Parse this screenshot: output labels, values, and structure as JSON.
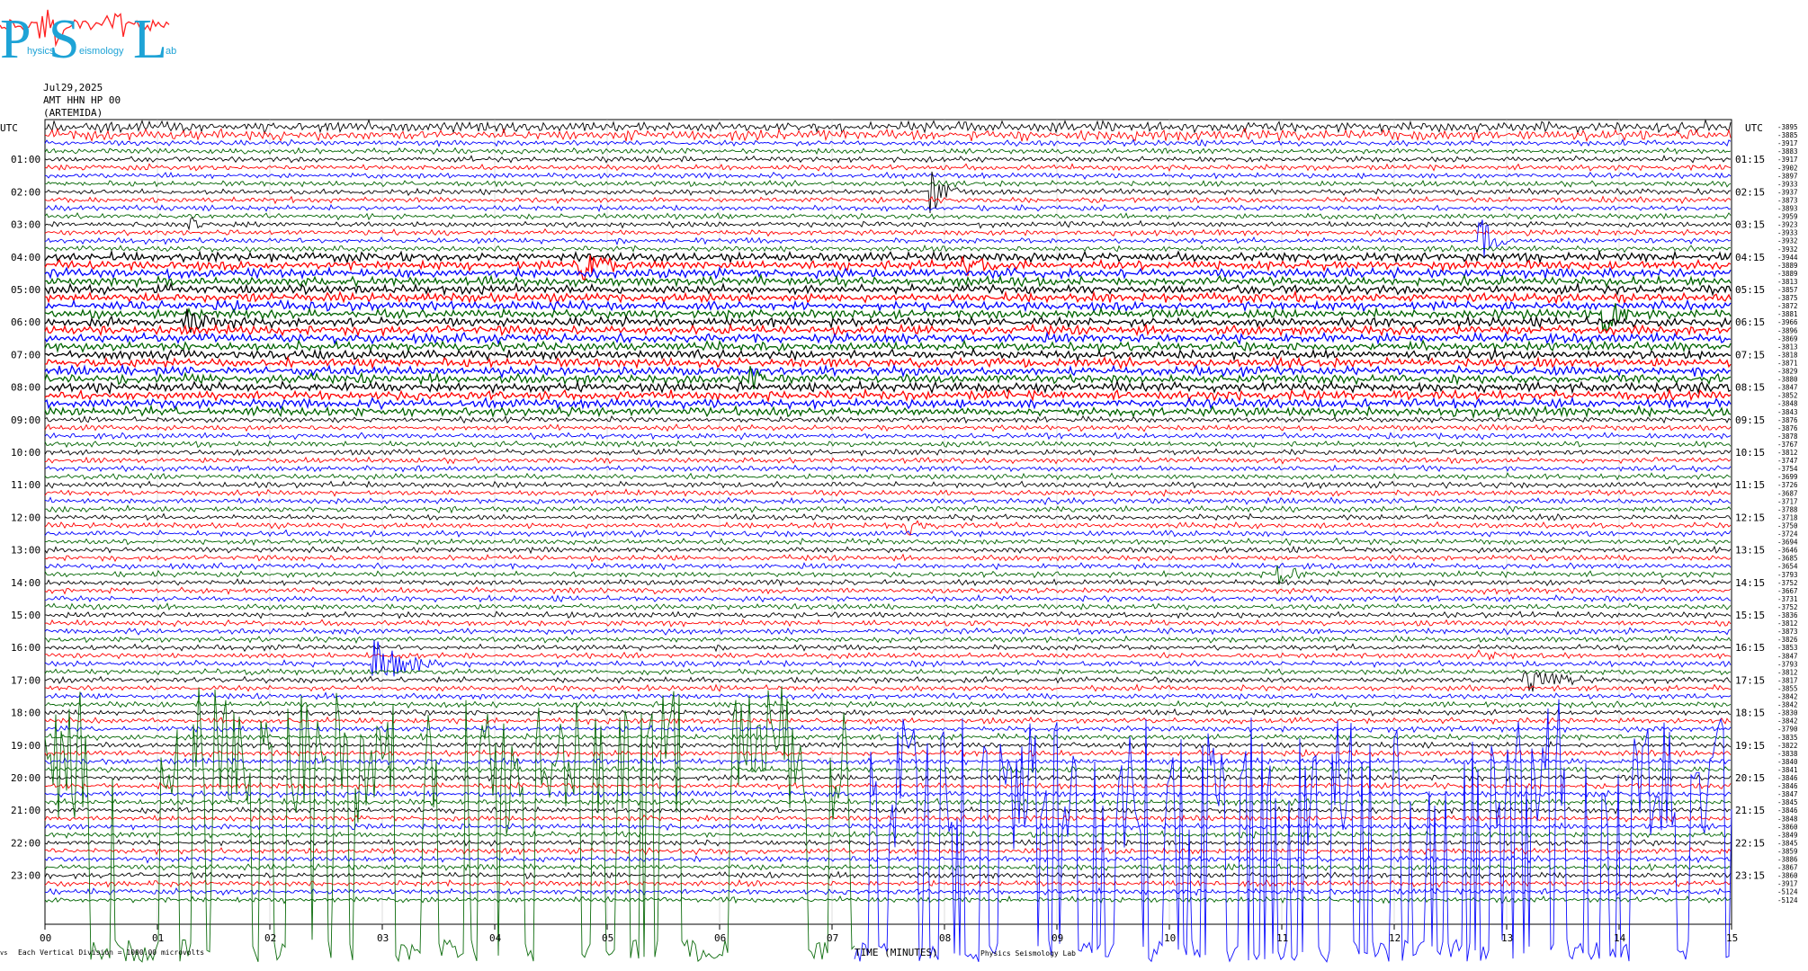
{
  "logo": {
    "letters": [
      "P",
      "S",
      "L"
    ],
    "words": [
      "hysics",
      "eismology",
      "ab"
    ],
    "color": "#1ea3d6",
    "trace_color": "#ff2020"
  },
  "header": {
    "date": "Jul29,2025",
    "channel": "AMT HHN HP 00",
    "station": "(ARTEMIDA)"
  },
  "axis": {
    "left_unit": "UTC",
    "right_unit": "UTC",
    "minute_ticks": [
      "00",
      "01",
      "02",
      "03",
      "04",
      "05",
      "06",
      "07",
      "08",
      "09",
      "10",
      "11",
      "12",
      "13",
      "14",
      "15"
    ],
    "left_hours": [
      "01:00",
      "02:00",
      "03:00",
      "04:00",
      "05:00",
      "06:00",
      "07:00",
      "08:00",
      "09:00",
      "10:00",
      "11:00",
      "12:00",
      "13:00",
      "14:00",
      "15:00",
      "16:00",
      "17:00",
      "18:00",
      "19:00",
      "20:00",
      "21:00",
      "22:00",
      "23:00"
    ],
    "right_hours": [
      "01:15",
      "02:15",
      "03:15",
      "04:15",
      "05:15",
      "06:15",
      "07:15",
      "08:15",
      "09:15",
      "10:15",
      "11:15",
      "12:15",
      "13:15",
      "14:15",
      "15:15",
      "16:15",
      "17:15",
      "18:15",
      "19:15",
      "20:15",
      "21:15",
      "22:15",
      "23:15"
    ]
  },
  "footer": {
    "scale_note": "Each Vertical Division = 1000.00 microvolts",
    "time_label": "TIME (MINUTES)",
    "credit": "Physics Seismology Lab"
  },
  "chart_data": {
    "type": "line",
    "title": "",
    "xlabel": "TIME (MINUTES)",
    "ylabel": "UTC",
    "xlim": [
      0,
      15
    ],
    "rows_per_hour": 4,
    "row_minutes": 15,
    "total_rows": 96,
    "series_colors": [
      "#000000",
      "#ff0000",
      "#0000ff",
      "#006400"
    ],
    "right_counts": [
      "-3895",
      "-3885",
      "-3917",
      "-3883",
      "-3917",
      "-3902",
      "-3897",
      "-3933",
      "-3937",
      "-3873",
      "-3893",
      "-3959",
      "-3923",
      "-3933",
      "-3932",
      "-3932",
      "-3944",
      "-3889",
      "-3889",
      "-3813",
      "-3857",
      "-3875",
      "-3872",
      "-3881",
      "-3966",
      "-3896",
      "-3869",
      "-3813",
      "-3818",
      "-3871",
      "-3829",
      "-3880",
      "-3847",
      "-3852",
      "-3848",
      "-3843",
      "-3876",
      "-3876",
      "-3878",
      "-3767",
      "-3812",
      "-3747",
      "-3754",
      "-3699",
      "-3726",
      "-3687",
      "-3717",
      "-3788",
      "-3718",
      "-3750",
      "-3724",
      "-3694",
      "-3646",
      "-3685",
      "-3654",
      "-3793",
      "-3752",
      "-3667",
      "-3731",
      "-3752",
      "-3836",
      "-3812",
      "-3873",
      "-3826",
      "-3853",
      "-3847",
      "-3793",
      "-3812",
      "-3817",
      "-3855",
      "-3842",
      "-3842",
      "-3830",
      "-3842",
      "-3790",
      "-3835",
      "-3822",
      "-3838",
      "-3840",
      "-3841",
      "-3846",
      "-3846",
      "-3847",
      "-3845",
      "-3846",
      "-3848",
      "-3860",
      "-3849",
      "-3845",
      "-3859",
      "-3886",
      "-3867",
      "-3860",
      "-3917",
      "-5124",
      "-5124"
    ],
    "events": [
      {
        "row": 8,
        "minute": 7.92,
        "amp": 1.0,
        "width": 0.25,
        "color": "#006400"
      },
      {
        "row": 12,
        "minute": 1.32,
        "amp": 0.35,
        "width": 0.12,
        "color": "#ff0000"
      },
      {
        "row": 14,
        "minute": 12.8,
        "amp": 1.0,
        "width": 0.25,
        "color": "#000000"
      },
      {
        "row": 17,
        "minute": 4.8,
        "amp": 0.55,
        "width": 0.8,
        "color": "#0000ff"
      },
      {
        "row": 17,
        "minute": 8.2,
        "amp": 0.45,
        "width": 0.5,
        "color": "#ff0000"
      },
      {
        "row": 24,
        "minute": 1.3,
        "amp": 0.45,
        "width": 0.6,
        "color": "#000000"
      },
      {
        "row": 23,
        "minute": 13.9,
        "amp": 0.8,
        "width": 0.3,
        "color": "#000000"
      },
      {
        "row": 31,
        "minute": 6.3,
        "amp": 0.55,
        "width": 0.3,
        "color": "#000000"
      },
      {
        "row": 49,
        "minute": 7.7,
        "amp": 0.4,
        "width": 0.3,
        "color": "#0000ff"
      },
      {
        "row": 55,
        "minute": 11.0,
        "amp": 0.5,
        "width": 0.3,
        "color": "#006400"
      },
      {
        "row": 66,
        "minute": 2.95,
        "amp": 1.0,
        "width": 0.6,
        "color": "#0000ff"
      },
      {
        "row": 65,
        "minute": 12.8,
        "amp": 0.3,
        "width": 0.3,
        "color": "#ff0000"
      },
      {
        "row": 68,
        "minute": 13.2,
        "amp": 0.6,
        "width": 0.7,
        "color": "#000000"
      }
    ],
    "noisy_rows": [
      16,
      35
    ],
    "bursts": [
      {
        "start_row": 68,
        "end_row": 95,
        "x_start": 0,
        "x_end": 7.2,
        "color": "#006400",
        "density": 0.45
      },
      {
        "start_row": 70,
        "end_row": 95,
        "x_start": 7.2,
        "x_end": 15,
        "color": "#0000ff",
        "density": 0.75
      }
    ]
  }
}
